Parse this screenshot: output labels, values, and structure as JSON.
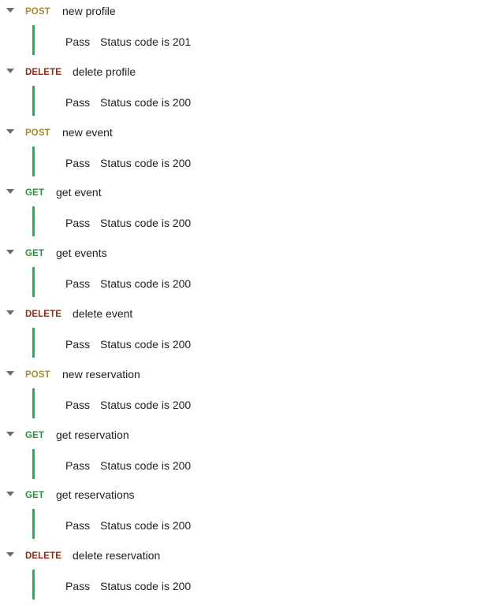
{
  "requests": [
    {
      "method": "POST",
      "name": "new profile",
      "result": "Pass",
      "test": "Status code is 201"
    },
    {
      "method": "DELETE",
      "name": "delete profile",
      "result": "Pass",
      "test": "Status code is 200"
    },
    {
      "method": "POST",
      "name": "new event",
      "result": "Pass",
      "test": "Status code is 200"
    },
    {
      "method": "GET",
      "name": "get event",
      "result": "Pass",
      "test": "Status code is 200"
    },
    {
      "method": "GET",
      "name": "get events",
      "result": "Pass",
      "test": "Status code is 200"
    },
    {
      "method": "DELETE",
      "name": "delete event",
      "result": "Pass",
      "test": "Status code is 200"
    },
    {
      "method": "POST",
      "name": "new reservation",
      "result": "Pass",
      "test": "Status code is 200"
    },
    {
      "method": "GET",
      "name": "get reservation",
      "result": "Pass",
      "test": "Status code is 200"
    },
    {
      "method": "GET",
      "name": "get reservations",
      "result": "Pass",
      "test": "Status code is 200"
    },
    {
      "method": "DELETE",
      "name": "delete reservation",
      "result": "Pass",
      "test": "Status code is 200"
    }
  ],
  "colors": {
    "post": "#a88a2d",
    "delete": "#8f2c14",
    "get": "#2f8a43",
    "pass_bar": "#21b14f"
  },
  "icons": {
    "expand": "chevron-down-icon"
  }
}
